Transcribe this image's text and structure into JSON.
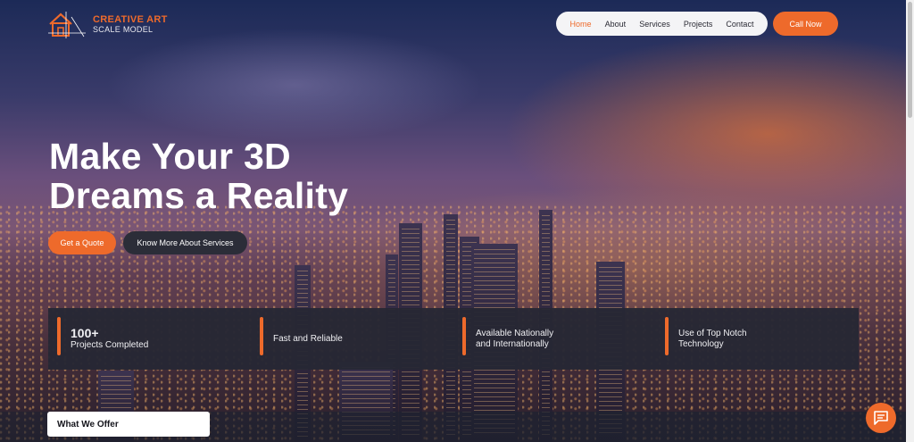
{
  "brand": {
    "name_line1": "CREATIVE ART",
    "name_line2": "SCALE MODEL",
    "accent_color": "#ee6a2b"
  },
  "nav": {
    "items": [
      {
        "label": "Home",
        "active": true
      },
      {
        "label": "About"
      },
      {
        "label": "Services"
      },
      {
        "label": "Projects"
      },
      {
        "label": "Contact"
      }
    ],
    "call_label": "Call Now"
  },
  "hero": {
    "headline_line1": "Make Your 3D",
    "headline_line2": "Dreams a Reality",
    "quote_button": "Get a Quote",
    "services_button": "Know More About Services"
  },
  "features": [
    {
      "big": "100+",
      "line1": "Projects Completed",
      "line2": ""
    },
    {
      "big": "",
      "line1": "Fast and Reliable",
      "line2": ""
    },
    {
      "big": "",
      "line1": "Available Nationally",
      "line2": "and Internationally"
    },
    {
      "big": "",
      "line1": "Use of Top Notch",
      "line2": "Technology"
    }
  ],
  "offer_tab": "What We Offer",
  "icons": {
    "logo": "house-blueprint-icon",
    "chat": "chat-bubble-icon"
  }
}
